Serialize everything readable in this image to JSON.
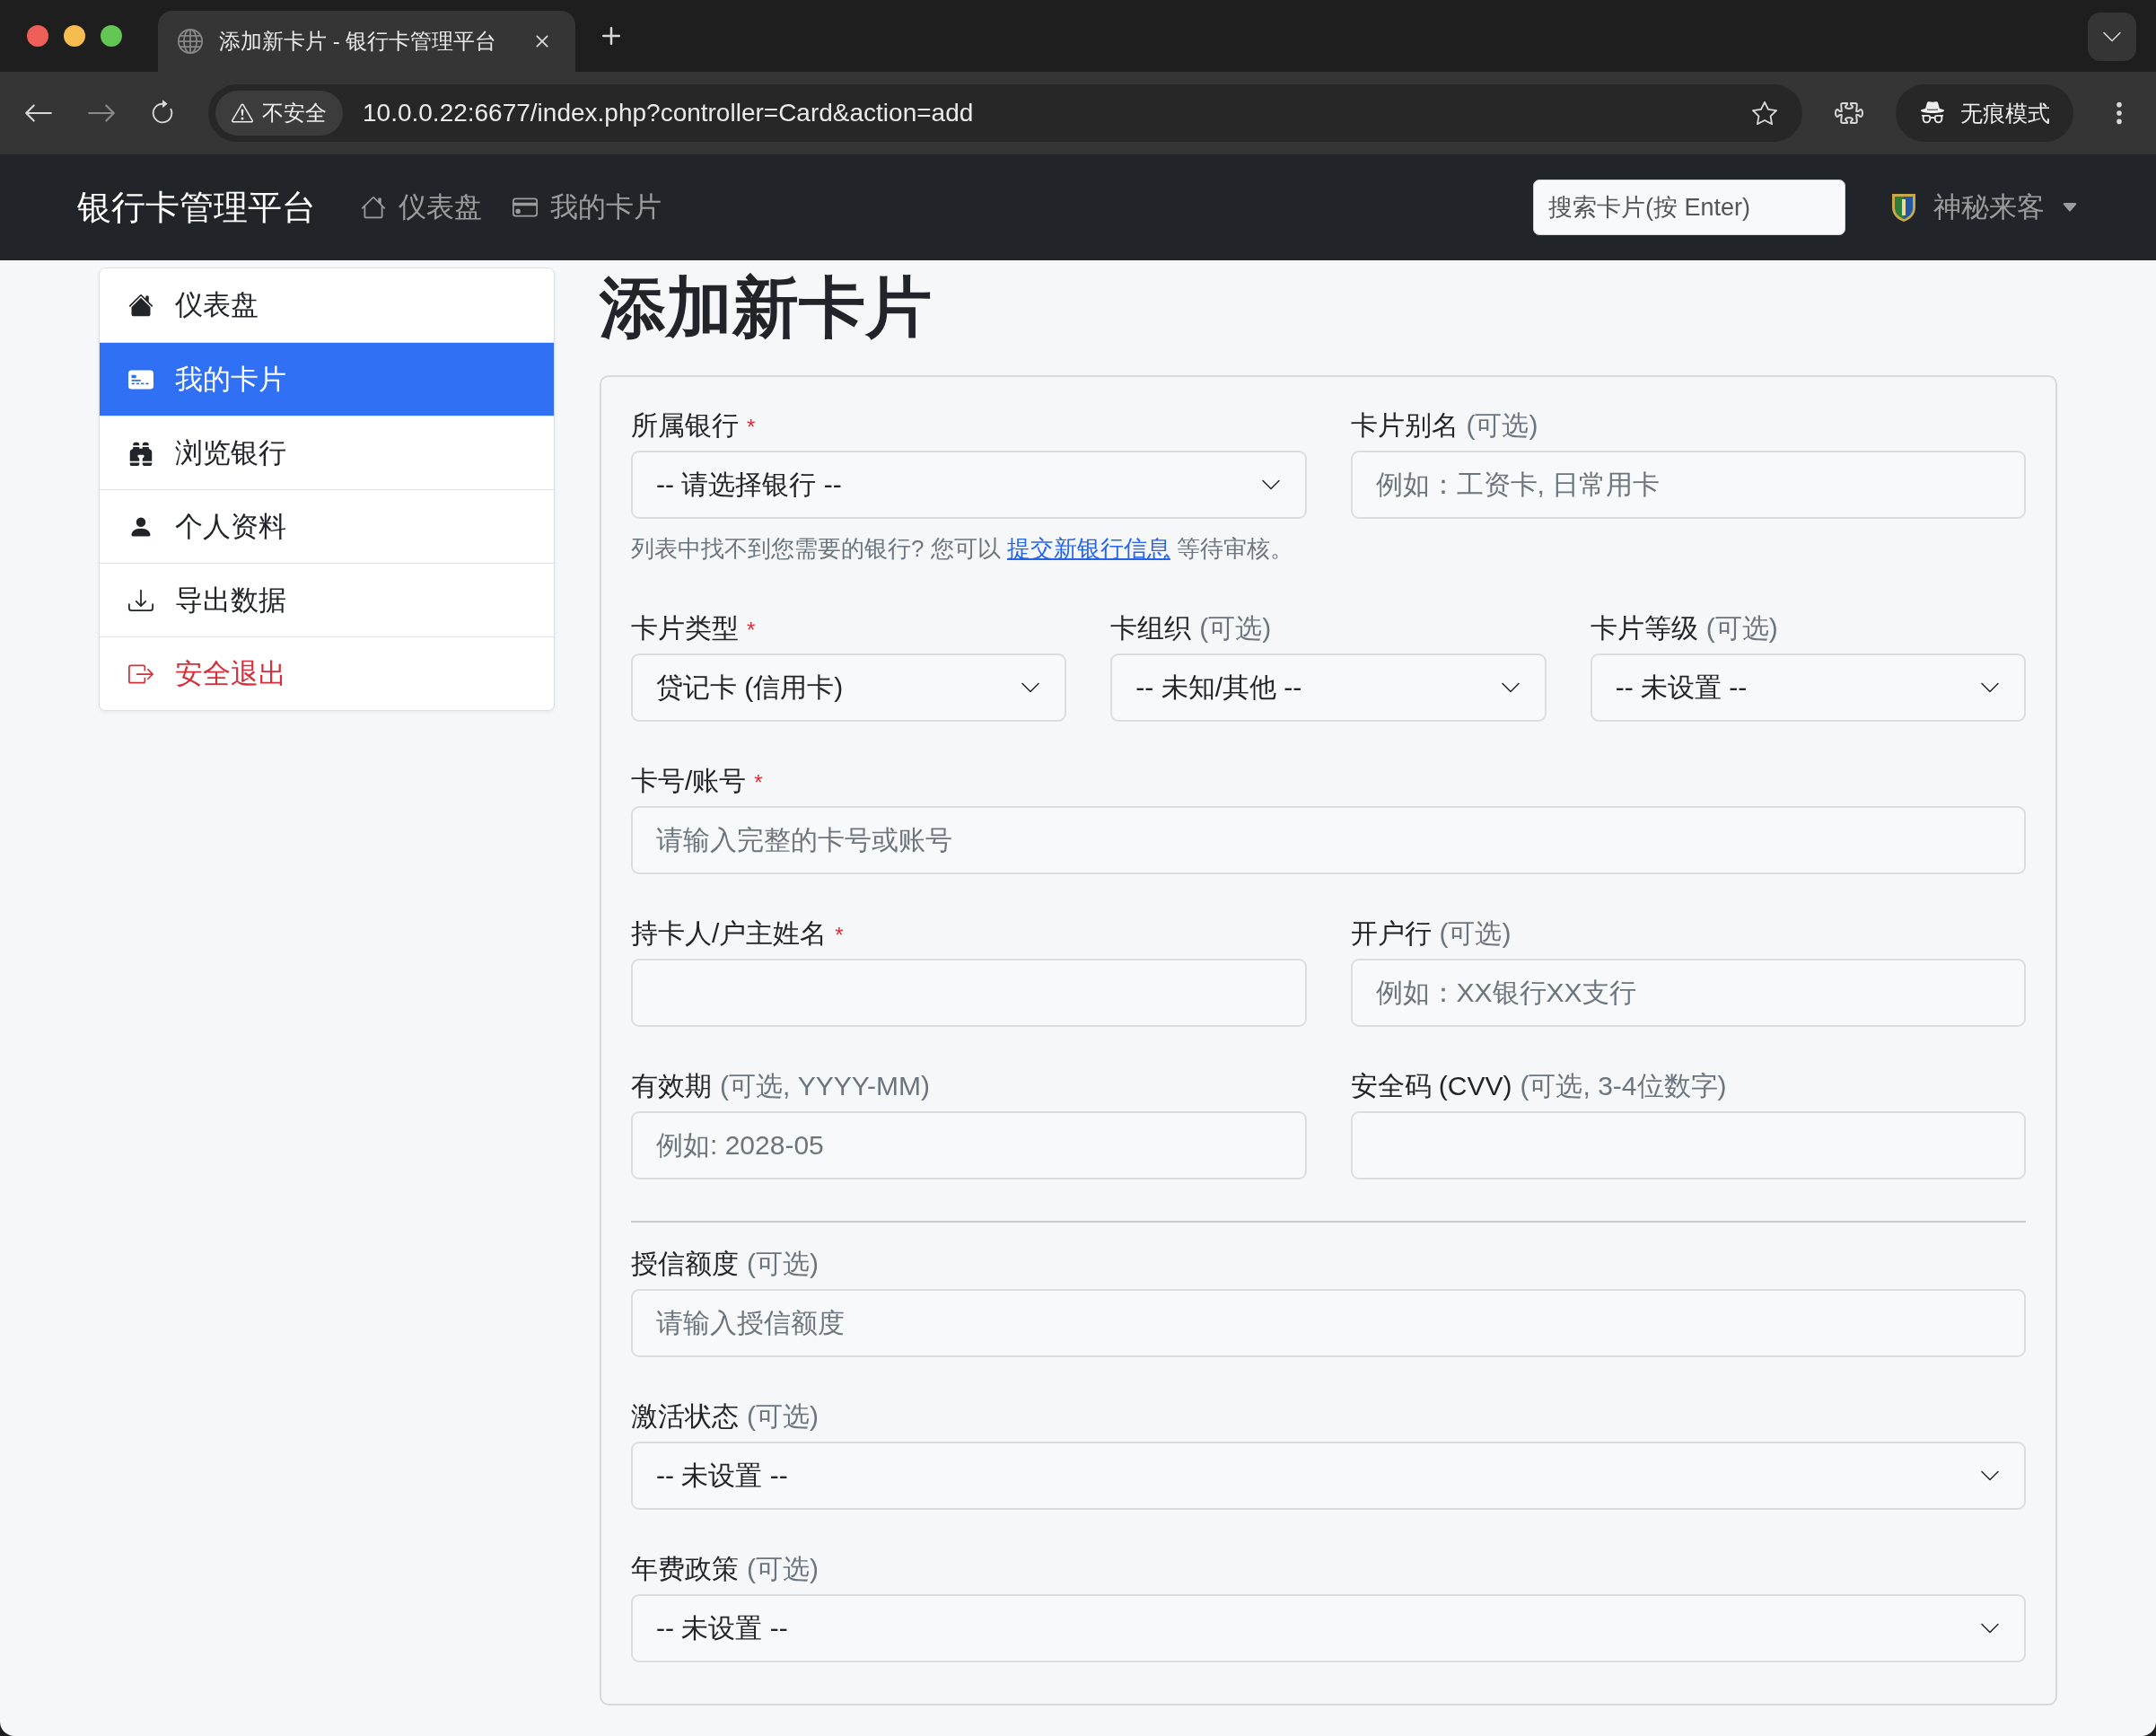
{
  "browser": {
    "tab_title": "添加新卡片 - 银行卡管理平台",
    "security_label": "不安全",
    "url": "10.0.0.22:6677/index.php?controller=Card&action=add",
    "profile_label": "无痕模式"
  },
  "navbar": {
    "brand": "银行卡管理平台",
    "links": [
      {
        "label": "仪表盘"
      },
      {
        "label": "我的卡片"
      }
    ],
    "search": {
      "placeholder": "搜索卡片(按 Enter)"
    },
    "user": "神秘来客"
  },
  "sidebar": {
    "items": [
      {
        "label": "仪表盘",
        "selected": false,
        "kind": "normal"
      },
      {
        "label": "我的卡片",
        "selected": true,
        "kind": "normal"
      },
      {
        "label": "浏览银行",
        "selected": false,
        "kind": "normal"
      },
      {
        "label": "个人资料",
        "selected": false,
        "kind": "normal"
      },
      {
        "label": "导出数据",
        "selected": false,
        "kind": "normal"
      },
      {
        "label": "安全退出",
        "selected": false,
        "kind": "danger"
      }
    ]
  },
  "page_title": "添加新卡片",
  "form": {
    "rows": [
      {
        "kind": "fields",
        "fields": [
          {
            "label": "所属银行",
            "required_mark": "*",
            "kind": "select",
            "value": "-- 请选择银行 --",
            "help": {
              "before": "列表中找不到您需要的银行?  您可以 ",
              "link": "提交新银行信息",
              "after": " 等待审核。"
            }
          },
          {
            "label": "卡片别名",
            "note": "(可选)",
            "kind": "input",
            "placeholder": "例如：工资卡, 日常用卡"
          }
        ]
      },
      {
        "kind": "fields",
        "fields": [
          {
            "label": "卡片类型",
            "required_mark": "*",
            "kind": "select",
            "value": "贷记卡 (信用卡)"
          },
          {
            "label": "卡组织",
            "note": "(可选)",
            "kind": "select",
            "value": "-- 未知/其他 --"
          },
          {
            "label": "卡片等级",
            "note": "(可选)",
            "kind": "select",
            "value": "-- 未设置 --"
          }
        ]
      },
      {
        "kind": "fields",
        "fields": [
          {
            "label": "卡号/账号",
            "required_mark": "*",
            "kind": "input",
            "placeholder": "请输入完整的卡号或账号"
          }
        ]
      },
      {
        "kind": "fields",
        "fields": [
          {
            "label": "持卡人/户主姓名",
            "required_mark": "*",
            "kind": "input"
          },
          {
            "label": "开户行",
            "note": "(可选)",
            "kind": "input",
            "placeholder": "例如：XX银行XX支行"
          }
        ]
      },
      {
        "kind": "fields",
        "fields": [
          {
            "label": "有效期",
            "note": "(可选, YYYY-MM)",
            "kind": "input",
            "placeholder": "例如: 2028-05"
          },
          {
            "label": "安全码 (CVV)",
            "note": "(可选, 3-4位数字)",
            "kind": "input"
          }
        ]
      },
      {
        "kind": "divider"
      },
      {
        "kind": "fields",
        "fields": [
          {
            "label": "授信额度",
            "note": "(可选)",
            "kind": "input",
            "placeholder": "请输入授信额度"
          }
        ]
      },
      {
        "kind": "fields",
        "fields": [
          {
            "label": "激活状态",
            "note": "(可选)",
            "kind": "select",
            "value": "-- 未设置 --"
          }
        ]
      },
      {
        "kind": "fields",
        "fields": [
          {
            "label": "年费政策",
            "note": "(可选)",
            "kind": "select",
            "value": "-- 未设置 --"
          }
        ]
      }
    ]
  }
}
